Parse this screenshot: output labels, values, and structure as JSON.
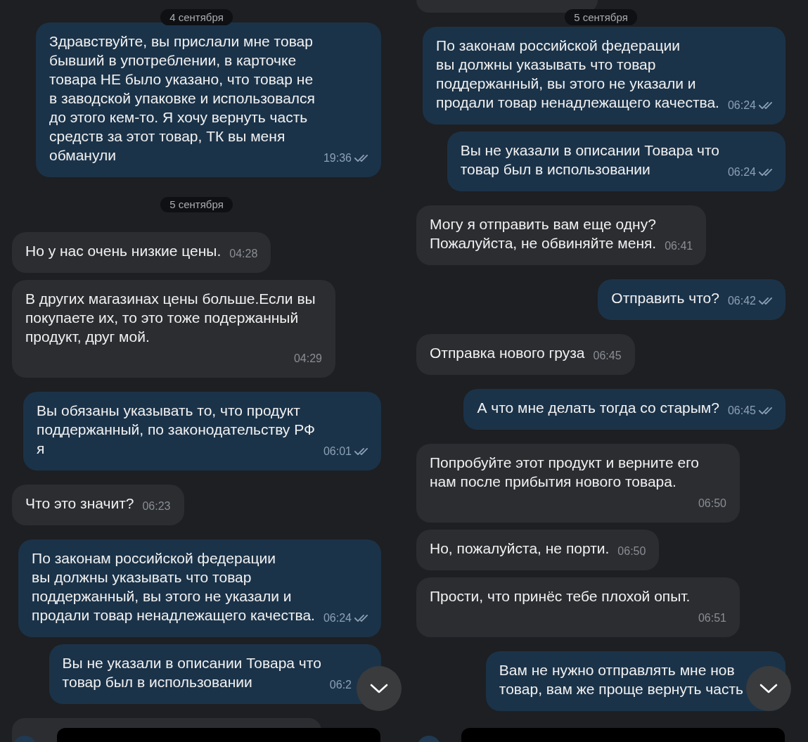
{
  "panels": [
    {
      "date_header": "4 сентября",
      "items": [
        {
          "kind": "message",
          "outgoing": true,
          "text": "Здравствуйте, вы прислали мне товар\nбывший в употреблении, в карточке\nтовара НЕ было указано, что товар не\nв заводской упаковке и использовался\nдо этого кем-то. Я хочу вернуть часть\nсредств за этот товар, ТК вы меня\nобманули",
          "time": "19:36",
          "read": true
        },
        {
          "kind": "date",
          "text": "5 сентября"
        },
        {
          "kind": "message",
          "outgoing": false,
          "text": "Но у нас очень низкие цены.",
          "time": "04:28"
        },
        {
          "kind": "message",
          "outgoing": false,
          "text": "В других магазинах цены больше.Если вы\nпокупаете их, то это тоже подержанный\nпродукт, друг мой.",
          "time": "04:29"
        },
        {
          "kind": "message",
          "outgoing": true,
          "text": "Вы обязаны указывать то, что продукт\nподдержанный, по законодательству РФ\nя",
          "time": "06:01",
          "read": true
        },
        {
          "kind": "message",
          "outgoing": false,
          "text": "Что это значит?",
          "time": "06:23"
        },
        {
          "kind": "message",
          "outgoing": true,
          "text": "По законам российской федерации\nвы должны указывать что товар\nподдержанный, вы этого не указали и\nпродали товар ненадлежащего качества.",
          "time": "06:24",
          "read": true
        },
        {
          "kind": "message",
          "outgoing": true,
          "text": "Вы не указали в описании Товара что\nтовар был в использовании",
          "time": "06:2"
        },
        {
          "kind": "cut",
          "outgoing": false
        }
      ]
    },
    {
      "date_header": "5 сентября",
      "items": [
        {
          "kind": "cut",
          "outgoing": false
        },
        {
          "kind": "message",
          "outgoing": true,
          "text": "По законам российской федерации\nвы должны указывать что товар\nподдержанный, вы этого не указали и\nпродали товар ненадлежащего качества.",
          "time": "06:24",
          "read": true
        },
        {
          "kind": "message",
          "outgoing": true,
          "text": "Вы не указали в описании Товара что\nтовар был в использовании",
          "time": "06:24",
          "read": true
        },
        {
          "kind": "message",
          "outgoing": false,
          "text": "Могу я отправить вам еще одну?\nПожалуйста, не обвиняйте меня.",
          "time": "06:41"
        },
        {
          "kind": "message",
          "outgoing": true,
          "text": "Отправить что?",
          "time": "06:42",
          "read": true
        },
        {
          "kind": "message",
          "outgoing": false,
          "text": "Отправка нового груза",
          "time": "06:45"
        },
        {
          "kind": "message",
          "outgoing": true,
          "text": "А что мне делать тогда со старым?",
          "time": "06:45",
          "read": true
        },
        {
          "kind": "message",
          "outgoing": false,
          "text": "Попробуйте этот продукт и верните его\nнам после прибытия нового товара.",
          "time": "06:50"
        },
        {
          "kind": "message",
          "outgoing": false,
          "text": "Но, пожалуйста, не порти.",
          "time": "06:50"
        },
        {
          "kind": "message",
          "outgoing": false,
          "text": "Прости, что принёс тебе плохой опыт.",
          "time": "06:51"
        },
        {
          "kind": "message",
          "outgoing": true,
          "text": "Вам не нужно отправлять мне нов\nтовар, вам же проще вернуть часть"
        }
      ]
    }
  ]
}
